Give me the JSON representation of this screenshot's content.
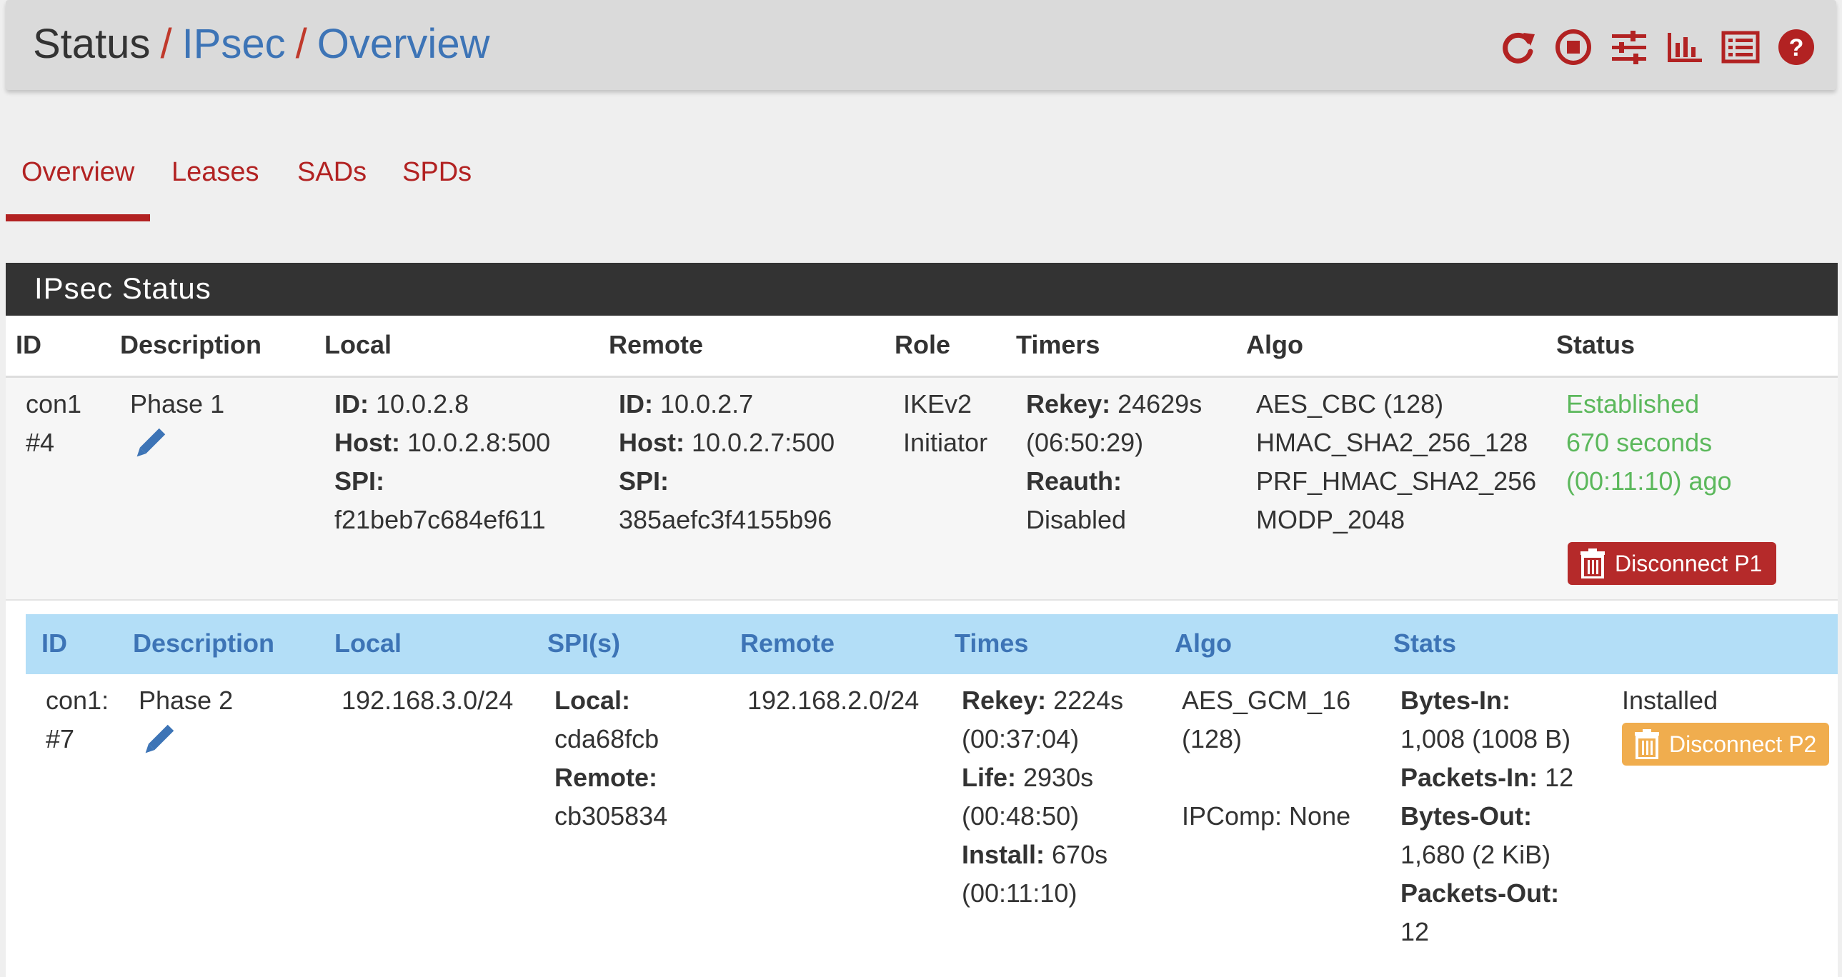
{
  "header": {
    "breadcrumb": [
      "Status",
      "IPsec",
      "Overview"
    ],
    "separator": "/",
    "icons": [
      "refresh-icon",
      "stop-icon",
      "sliders-icon",
      "bar-chart-icon",
      "list-icon",
      "help-icon"
    ],
    "accent_color": "#b22222",
    "link_color": "#3d74b6"
  },
  "tabs": [
    {
      "label": "Overview",
      "active": true
    },
    {
      "label": "Leases",
      "active": false
    },
    {
      "label": "SADs",
      "active": false
    },
    {
      "label": "SPDs",
      "active": false
    }
  ],
  "panel": {
    "title": "IPsec Status",
    "columns": [
      "ID",
      "Description",
      "Local",
      "Remote",
      "Role",
      "Timers",
      "Algo",
      "Status"
    ],
    "p1": {
      "id": [
        "con1",
        "#4"
      ],
      "description": "Phase 1",
      "local": {
        "id_label": "ID:",
        "id": "10.0.2.8",
        "host_label": "Host:",
        "host": "10.0.2.8:500",
        "spi_label": "SPI:",
        "spi": "f21beb7c684ef611"
      },
      "remote": {
        "id_label": "ID:",
        "id": "10.0.2.7",
        "host_label": "Host:",
        "host": "10.0.2.7:500",
        "spi_label": "SPI:",
        "spi": "385aefc3f4155b96"
      },
      "role": [
        "IKEv2",
        "Initiator"
      ],
      "timers": {
        "rekey_label": "Rekey:",
        "rekey": "24629s",
        "rekey_time": "(06:50:29)",
        "reauth_label": "Reauth:",
        "reauth": "Disabled"
      },
      "algo": [
        "AES_CBC (128)",
        "HMAC_SHA2_256_128",
        "PRF_HMAC_SHA2_256",
        "MODP_2048"
      ],
      "status": [
        "Established",
        "670 seconds",
        "(00:11:10) ago"
      ],
      "disconnect_label": "Disconnect P1"
    },
    "p2_columns": [
      "ID",
      "Description",
      "Local",
      "SPI(s)",
      "Remote",
      "Times",
      "Algo",
      "Stats"
    ],
    "p2": {
      "id": [
        "con1:",
        "#7"
      ],
      "description": "Phase 2",
      "local": "192.168.3.0/24",
      "spi": {
        "local_label": "Local:",
        "local": "cda68fcb",
        "remote_label": "Remote:",
        "remote": "cb305834"
      },
      "remote": "192.168.2.0/24",
      "times": {
        "rekey_label": "Rekey:",
        "rekey": "2224s",
        "rekey_time": "(00:37:04)",
        "life_label": "Life:",
        "life": "2930s",
        "life_time": "(00:48:50)",
        "install_label": "Install:",
        "install": "670s",
        "install_time": "(00:11:10)"
      },
      "algo": [
        "AES_GCM_16",
        "(128)",
        "IPComp: None"
      ],
      "stats": {
        "bytes_in_label": "Bytes-In:",
        "bytes_in": "1,008 (1008 B)",
        "packets_in_label": "Packets-In:",
        "packets_in": "12",
        "bytes_out_label": "Bytes-Out:",
        "bytes_out": "1,680 (2 KiB)",
        "packets_out_label": "Packets-Out:",
        "packets_out": "12"
      },
      "state": "Installed",
      "disconnect_label": "Disconnect P2"
    }
  }
}
